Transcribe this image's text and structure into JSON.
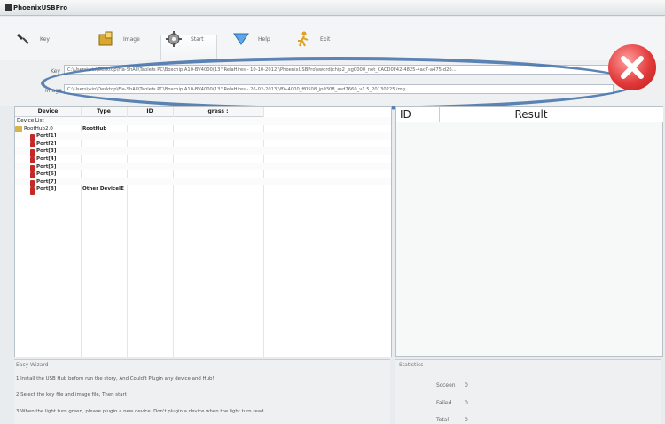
{
  "window": {
    "title": "PhoenixUSBPro"
  },
  "toolbar": {
    "key": {
      "label": "Key",
      "icon": "wrench-icon"
    },
    "image": {
      "label": "Image",
      "icon": "package-icon"
    },
    "start": {
      "label": "Start",
      "icon": "gear-icon"
    },
    "help": {
      "label": "Help",
      "icon": "help-icon"
    },
    "exit": {
      "label": "Exit",
      "icon": "exit-icon"
    }
  },
  "paths": {
    "key_label": "Key",
    "image_label": "Image",
    "key_value": "C:\\Users\\win\\Desktop\\Fla-ShAll\\Tablets PC\\Boxchip A10-BV4000(13\" RelaHires - 10-10-2012)\\PhoenixUSBPro\\sword(chip2_jsg0000_net_CACD0F42-4825-4ac7-a475-d26...",
    "image_value": "C:\\Users\\win\\Desktop\\Fla-ShAll\\Tablets PC\\Boxchip A10-BV4000(13\" RelaHires - 26-02-2013)\\BV-4000_ff0508_jp0308_asd7660_v1.5_20130225.img"
  },
  "grid": {
    "headers": [
      "Device",
      "Type",
      "ID",
      "gress :"
    ],
    "rows": [
      {
        "device": "Device List",
        "type": "",
        "id": "",
        "progress": ""
      },
      {
        "device": "RootHub2.0",
        "type": "RootHub",
        "id": "",
        "progress": ""
      },
      {
        "device": "Port[1]",
        "type": "",
        "id": "",
        "progress": ""
      },
      {
        "device": "Port[2]",
        "type": "",
        "id": "",
        "progress": ""
      },
      {
        "device": "Port[3]",
        "type": "",
        "id": "",
        "progress": ""
      },
      {
        "device": "Port[4]",
        "type": "",
        "id": "",
        "progress": ""
      },
      {
        "device": "Port[5]",
        "type": "",
        "id": "",
        "progress": ""
      },
      {
        "device": "Port[6]",
        "type": "",
        "id": "",
        "progress": ""
      },
      {
        "device": "Port[7]",
        "type": "",
        "id": "",
        "progress": ""
      },
      {
        "device": "Port[8]",
        "type": "Other DeviceIE",
        "id": "",
        "progress": ""
      }
    ]
  },
  "result": {
    "headers": [
      "ID",
      "Result"
    ]
  },
  "wizard": {
    "title": "Easy Wizard",
    "lines": [
      "1.Install the USB Hub before run the story, And Could't Plugin any device and Hub!",
      "2.Select the key file and image file, Then start",
      "3.When the light turn green, please plugin a new device. Don't plugin a device when the light turn read"
    ]
  },
  "statistics": {
    "title": "Statistics",
    "success_label": "Scceen",
    "success_value": "0",
    "failed_label": "Failed",
    "failed_value": "0",
    "total_label": "Total",
    "total_value": "0"
  },
  "colors": {
    "highlight_ellipse": "#3f6fa8",
    "close_red": "#e23a3a",
    "port_red": "#c62828"
  }
}
